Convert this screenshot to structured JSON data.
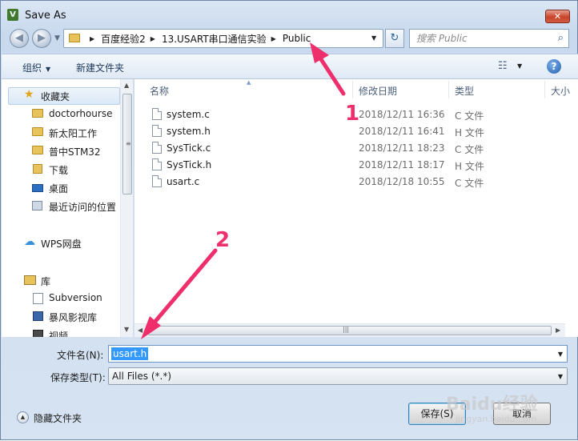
{
  "window": {
    "title": "Save As",
    "app_icon_letter": "V",
    "close_glyph": "✕"
  },
  "address": {
    "breadcrumbs": [
      "百度经验2",
      "13.USART串口通信实验",
      "Public"
    ],
    "separator": "▶"
  },
  "search": {
    "placeholder": "搜索 Public"
  },
  "toolbar": {
    "organize_label": "组织",
    "new_folder_label": "新建文件夹",
    "help_glyph": "?"
  },
  "sidebar": {
    "items": [
      {
        "label": "收藏夹",
        "icon": "star-icon"
      },
      {
        "label": "doctorhourse",
        "icon": "folder-icon"
      },
      {
        "label": "新太阳工作",
        "icon": "folder-icon"
      },
      {
        "label": "普中STM32",
        "icon": "folder-icon"
      },
      {
        "label": "下载",
        "icon": "download-folder-icon"
      },
      {
        "label": "桌面",
        "icon": "desktop-icon"
      },
      {
        "label": "最近访问的位置",
        "icon": "recent-places-icon"
      },
      {
        "label": "WPS网盘",
        "icon": "cloud-icon"
      },
      {
        "label": "库",
        "icon": "library-icon"
      },
      {
        "label": "Subversion",
        "icon": "svn-icon"
      },
      {
        "label": "暴风影视库",
        "icon": "storm-library-icon"
      },
      {
        "label": "视频",
        "icon": "video-icon"
      }
    ]
  },
  "filelist": {
    "columns": [
      "名称",
      "修改日期",
      "类型",
      "大小"
    ],
    "files": [
      {
        "name": "system.c",
        "modified": "2018/12/11 16:36",
        "type": "C 文件"
      },
      {
        "name": "system.h",
        "modified": "2018/12/11 16:41",
        "type": "H 文件"
      },
      {
        "name": "SysTick.c",
        "modified": "2018/12/11 18:23",
        "type": "C 文件"
      },
      {
        "name": "SysTick.h",
        "modified": "2018/12/11 18:17",
        "type": "H 文件"
      },
      {
        "name": "usart.c",
        "modified": "2018/12/18 10:55",
        "type": "C 文件"
      }
    ]
  },
  "form": {
    "filename_label": "文件名(N):",
    "filename_value": "usart.h",
    "filetype_label": "保存类型(T):",
    "filetype_value": "All Files (*.*)"
  },
  "footer": {
    "hide_folders_label": "隐藏文件夹",
    "save_label": "保存(S)",
    "cancel_label": "取消"
  },
  "annotations": {
    "marker_1": "1",
    "marker_2": "2",
    "color": "#ee2f6b"
  },
  "watermark": {
    "text": "Baidu经验",
    "sub": "jingyan.baidu.com"
  }
}
